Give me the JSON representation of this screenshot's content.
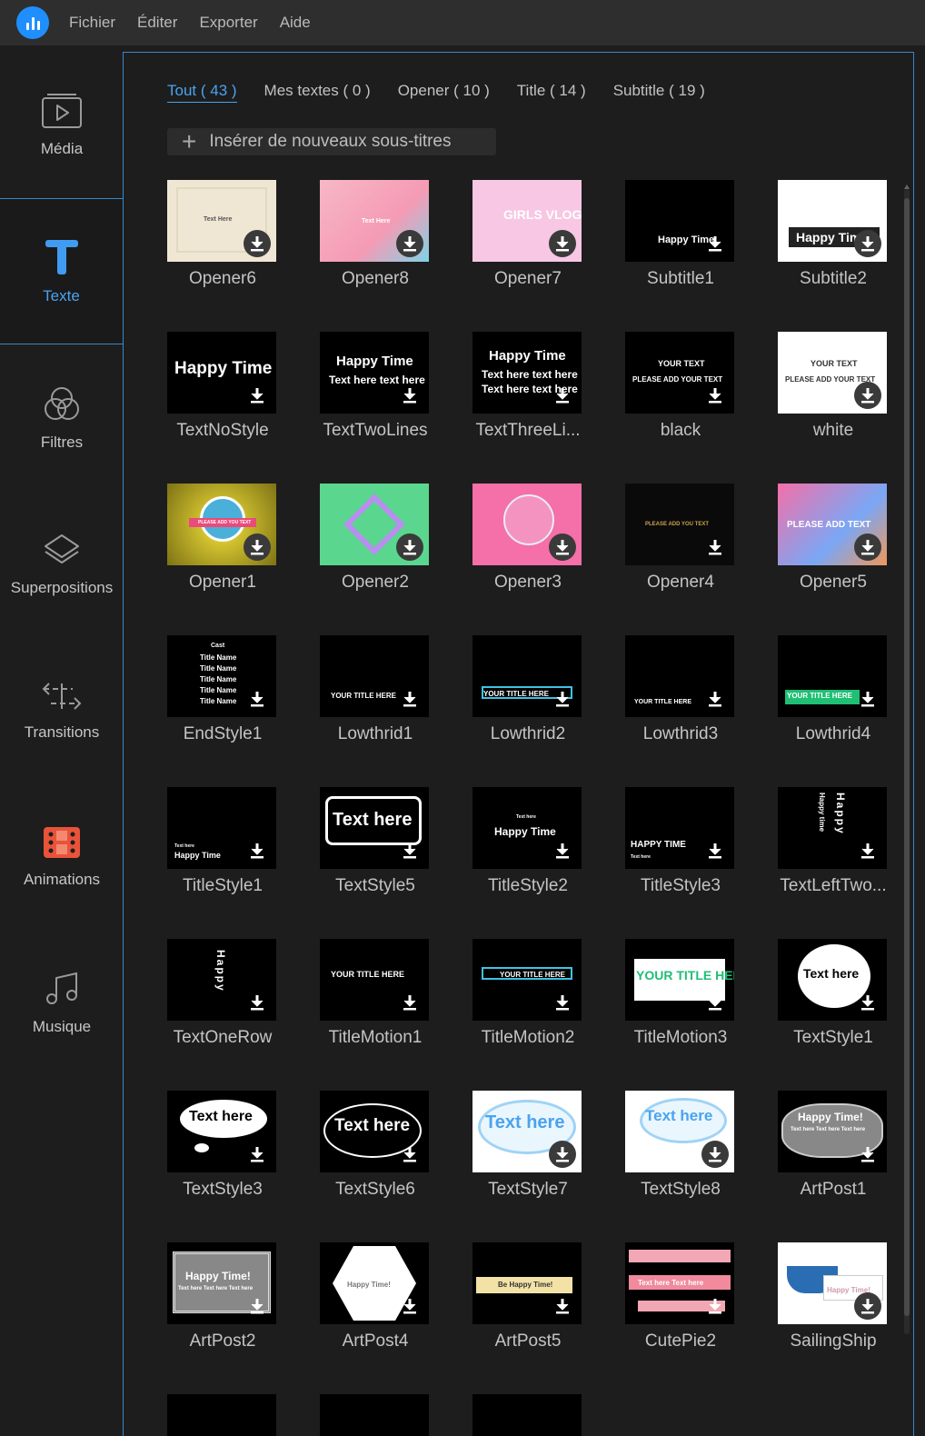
{
  "menu": {
    "items": [
      "Fichier",
      "Éditer",
      "Exporter",
      "Aide"
    ]
  },
  "sidebar": {
    "items": [
      {
        "label": "Média",
        "icon": "media-icon",
        "active": false
      },
      {
        "label": "Texte",
        "icon": "text-icon",
        "active": true
      },
      {
        "label": "Filtres",
        "icon": "filters-icon",
        "active": false
      },
      {
        "label": "Superpositions",
        "icon": "overlays-icon",
        "active": false
      },
      {
        "label": "Transitions",
        "icon": "transitions-icon",
        "active": false
      },
      {
        "label": "Animations",
        "icon": "animations-icon",
        "active": false
      },
      {
        "label": "Musique",
        "icon": "music-icon",
        "active": false
      }
    ]
  },
  "tabs": [
    {
      "label": "Tout ( 43 )",
      "active": true
    },
    {
      "label": "Mes textes ( 0 )",
      "active": false
    },
    {
      "label": "Opener ( 10 )",
      "active": false
    },
    {
      "label": "Title ( 14 )",
      "active": false
    },
    {
      "label": "Subtitle ( 19 )",
      "active": false
    }
  ],
  "insert_button": {
    "label": "Insérer de nouveaux sous-titres"
  },
  "cards": [
    {
      "label": "Opener6",
      "thumb_text": "Text Here"
    },
    {
      "label": "Opener8",
      "thumb_text": "Text Here"
    },
    {
      "label": "Opener7",
      "thumb_text": "GIRLS VLOG"
    },
    {
      "label": "Subtitle1",
      "thumb_text": "Happy Time"
    },
    {
      "label": "Subtitle2",
      "thumb_text": "Happy Tim"
    },
    {
      "label": "TextNoStyle",
      "thumb_text": "Happy Time"
    },
    {
      "label": "TextTwoLines",
      "thumb_text": "Happy Time",
      "thumb_text2": "Text here text here"
    },
    {
      "label": "TextThreeLi...",
      "thumb_text": "Happy Time",
      "thumb_text2": "Text here text here",
      "thumb_text3": "Text here text here"
    },
    {
      "label": "black",
      "thumb_text": "YOUR TEXT",
      "thumb_text2": "PLEASE ADD YOUR TEXT"
    },
    {
      "label": "white",
      "thumb_text": "YOUR TEXT",
      "thumb_text2": "PLEASE ADD YOUR TEXT"
    },
    {
      "label": "Opener1",
      "thumb_text": "PLEASE ADD YOU TEXT"
    },
    {
      "label": "Opener2",
      "thumb_text": ""
    },
    {
      "label": "Opener3",
      "thumb_text": ""
    },
    {
      "label": "Opener4",
      "thumb_text": "PLEASE ADD YOU TEXT"
    },
    {
      "label": "Opener5",
      "thumb_text": "PLEASE ADD TEXT"
    },
    {
      "label": "EndStyle1",
      "thumb_text": "Cast",
      "thumb_text2": "Title Name"
    },
    {
      "label": "Lowthrid1",
      "thumb_text": "YOUR TITLE HERE"
    },
    {
      "label": "Lowthrid2",
      "thumb_text": "YOUR TITLE HERE"
    },
    {
      "label": "Lowthrid3",
      "thumb_text": "YOUR TITLE HERE"
    },
    {
      "label": "Lowthrid4",
      "thumb_text": "YOUR TITLE HERE"
    },
    {
      "label": "TitleStyle1",
      "thumb_text": "Happy Time",
      "thumb_text2": "Text here"
    },
    {
      "label": "TextStyle5",
      "thumb_text": "Text here"
    },
    {
      "label": "TitleStyle2",
      "thumb_text": "Happy Time",
      "thumb_text2": "Text here"
    },
    {
      "label": "TitleStyle3",
      "thumb_text": "HAPPY TIME",
      "thumb_text2": "Text here"
    },
    {
      "label": "TextLeftTwo...",
      "thumb_text": "Happy",
      "thumb_text2": "Happy time"
    },
    {
      "label": "TextOneRow",
      "thumb_text": "Happy"
    },
    {
      "label": "TitleMotion1",
      "thumb_text": "YOUR TITLE HERE"
    },
    {
      "label": "TitleMotion2",
      "thumb_text": "YOUR TITLE HERE"
    },
    {
      "label": "TitleMotion3",
      "thumb_text": "YOUR TITLE HERE",
      "thumb_text2": "YOUR TITLE HERE"
    },
    {
      "label": "TextStyle1",
      "thumb_text": "Text here"
    },
    {
      "label": "TextStyle3",
      "thumb_text": "Text here"
    },
    {
      "label": "TextStyle6",
      "thumb_text": "Text here"
    },
    {
      "label": "TextStyle7",
      "thumb_text": "Text here"
    },
    {
      "label": "TextStyle8",
      "thumb_text": "Text here"
    },
    {
      "label": "ArtPost1",
      "thumb_text": "Happy Time!",
      "thumb_text2": "Text here Text here Text here"
    },
    {
      "label": "ArtPost2",
      "thumb_text": "Happy Time!",
      "thumb_text2": "Text here Text here Text here"
    },
    {
      "label": "ArtPost4",
      "thumb_text": "Happy Time!"
    },
    {
      "label": "ArtPost5",
      "thumb_text": "Be Happy Time!"
    },
    {
      "label": "CutePie2",
      "thumb_text": "Text here Text here"
    },
    {
      "label": "SailingShip",
      "thumb_text": "Happy Time!"
    },
    {
      "label": "",
      "thumb_text": ""
    },
    {
      "label": "",
      "thumb_text": ""
    },
    {
      "label": "",
      "thumb_text": ""
    }
  ],
  "colors": {
    "accent": "#4aa3f0",
    "panel_border": "#3a86c8",
    "bg": "#1d1d1d"
  }
}
